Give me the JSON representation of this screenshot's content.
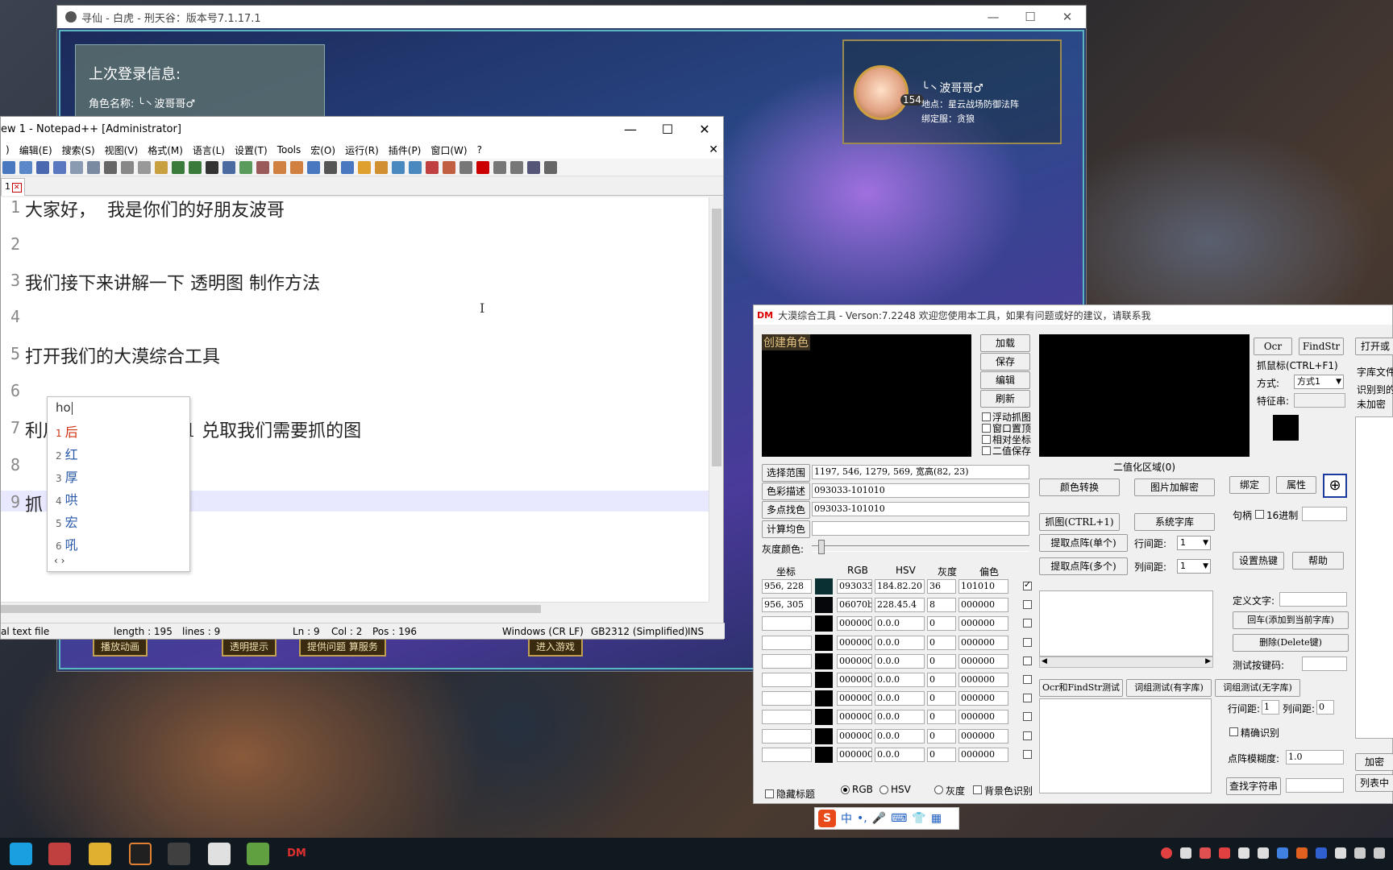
{
  "game": {
    "title": "寻仙 - 白虎 - 刑天谷：版本号7.1.17.1",
    "login_header": "上次登录信息:",
    "role_line": "角色名称: ╰丶波哥哥♂",
    "role_name": "╰丶波哥哥♂",
    "level": "154",
    "location": "地点：星云战场防御法阵",
    "server": "绑定服：贪狼",
    "btn_anim": "播放动画",
    "btn_tip": "透明提示",
    "btn_feedback": "提供问题 算服务",
    "btn_enter": "进入游戏"
  },
  "npp": {
    "title": "ew 1 - Notepad++ [Administrator]",
    "menu": [
      "编辑(E)",
      "搜索(S)",
      "视图(V)",
      "格式(M)",
      "语言(L)",
      "设置(T)",
      "Tools",
      "宏(O)",
      "运行(R)",
      "插件(P)",
      "窗口(W)",
      "?"
    ],
    "tab": "1",
    "lines": [
      {
        "n": "1",
        "t": "大家好，  我是你们的好朋友波哥"
      },
      {
        "n": "2",
        "t": ""
      },
      {
        "n": "3",
        "t": "我们接下来讲解一下 透明图 制作方法"
      },
      {
        "n": "4",
        "t": ""
      },
      {
        "n": "5",
        "t": "打开我们的大漠综合工具"
      },
      {
        "n": "6",
        "t": ""
      },
      {
        "n": "7",
        "t": "利用快捷键 CTRL+1 兑取我们需要抓的图"
      },
      {
        "n": "8",
        "t": ""
      },
      {
        "n": "9",
        "t": "抓"
      }
    ],
    "status": {
      "type": "al text file",
      "length": "length : 195",
      "lines": "lines : 9",
      "ln": "Ln : 9",
      "col": "Col : 2",
      "pos": "Pos : 196",
      "eol": "Windows (CR LF)",
      "enc": "GB2312 (Simplified)",
      "mode": "INS"
    }
  },
  "ime": {
    "input": "ho",
    "candidates": [
      {
        "n": "1",
        "c": "后"
      },
      {
        "n": "2",
        "c": "红"
      },
      {
        "n": "3",
        "c": "厚"
      },
      {
        "n": "4",
        "c": "哄"
      },
      {
        "n": "5",
        "c": "宏"
      },
      {
        "n": "6",
        "c": "吼"
      }
    ],
    "nav": "‹ ›"
  },
  "dm": {
    "logo": "DM",
    "title": "大漠综合工具 - Verson:7.2248  欢迎您使用本工具，如果有问题或好的建议，请联系我",
    "preview_label": "创建角色",
    "btn_load": "加载",
    "btn_save": "保存",
    "btn_edit": "编辑",
    "btn_refresh": "刷新",
    "chk_float": "浮动抓图",
    "chk_top": "窗口置顶",
    "chk_relative": "相对坐标",
    "chk_binary": "二值保存",
    "binary_area": "二值化区域(0)",
    "lbl_range": "选择范围",
    "val_range": "1197, 546, 1279, 569, 宽高(82, 23)",
    "lbl_color": "色彩描述",
    "val_color": "093033-101010",
    "lbl_multi": "多点找色",
    "val_multi": "093033-101010",
    "lbl_avg": "计算均色",
    "lbl_gray": "灰度颜色:",
    "col_coord": "坐标",
    "col_rgb": "RGB",
    "col_hsv": "HSV",
    "col_gray": "灰度",
    "col_offset": "偏色",
    "rows": [
      {
        "c": "956, 228",
        "rgb": "093033",
        "hsv": "184.82.20",
        "g": "36",
        "o": "101010",
        "on": true,
        "sw": "#0a3033"
      },
      {
        "c": "956, 305",
        "rgb": "06070b",
        "hsv": "228.45.4",
        "g": "8",
        "o": "000000",
        "on": false,
        "sw": "#06070b"
      },
      {
        "c": "",
        "rgb": "000000",
        "hsv": "0.0.0",
        "g": "0",
        "o": "000000",
        "on": false,
        "sw": "#000000"
      },
      {
        "c": "",
        "rgb": "000000",
        "hsv": "0.0.0",
        "g": "0",
        "o": "000000",
        "on": false,
        "sw": "#000000"
      },
      {
        "c": "",
        "rgb": "000000",
        "hsv": "0.0.0",
        "g": "0",
        "o": "000000",
        "on": false,
        "sw": "#000000"
      },
      {
        "c": "",
        "rgb": "000000",
        "hsv": "0.0.0",
        "g": "0",
        "o": "000000",
        "on": false,
        "sw": "#000000"
      },
      {
        "c": "",
        "rgb": "000000",
        "hsv": "0.0.0",
        "g": "0",
        "o": "000000",
        "on": false,
        "sw": "#000000"
      },
      {
        "c": "",
        "rgb": "000000",
        "hsv": "0.0.0",
        "g": "0",
        "o": "000000",
        "on": false,
        "sw": "#000000"
      },
      {
        "c": "",
        "rgb": "000000",
        "hsv": "0.0.0",
        "g": "0",
        "o": "000000",
        "on": false,
        "sw": "#000000"
      },
      {
        "c": "",
        "rgb": "000000",
        "hsv": "0.0.0",
        "g": "0",
        "o": "000000",
        "on": false,
        "sw": "#000000"
      }
    ],
    "chk_hide_title": "隐藏标题",
    "radio_rgb": "RGB",
    "radio_hsv": "HSV",
    "radio_gray": "灰度",
    "chk_bg": "背景色识别",
    "btn_colorconv": "颜色转换",
    "btn_imgdecrypt": "图片加解密",
    "btn_capture": "抓图(CTRL+1)",
    "btn_syslib": "系统字库",
    "btn_extract_single": "提取点阵(单个)",
    "btn_extract_multi": "提取点阵(多个)",
    "lbl_rowgap": "行间距:",
    "lbl_colgap": "列间距:",
    "val_rowgap": "1",
    "val_colgap": "1",
    "btn_ocr_test": "Ocr和FindStr测试",
    "btn_word_lib": "词组测试(有字库)",
    "btn_word_nolib": "词组测试(无字库)",
    "btn_ocr": "Ocr",
    "btn_findstr": "FindStr",
    "lbl_mouse": "抓鼠标(CTRL+F1)",
    "lbl_mode": "方式:",
    "val_mode": "方式1",
    "lbl_feature": "特征串:",
    "btn_bind": "绑定",
    "btn_prop": "属性",
    "lbl_handle": "句柄",
    "chk_hex": "16进制",
    "btn_hotkey": "设置热键",
    "btn_help": "帮助",
    "lbl_define": "定义文字:",
    "btn_enter_lib": "回车(添加到当前字库)",
    "btn_delete": "删除(Delete键)",
    "lbl_testkey": "测试按键码:",
    "lbl_rowgap2": "行间距:",
    "val_rowgap2": "1",
    "lbl_colgap2": "列间距:",
    "val_colgap2": "0",
    "chk_exact": "精确识别",
    "lbl_blur": "点阵模糊度:",
    "val_blur": "1.0",
    "btn_find": "查找字符串",
    "btn_open": "打开或",
    "lbl_libfile": "字库文件",
    "lbl_recog": "识别到的",
    "lbl_unenc": "未加密",
    "btn_addenc": "加密",
    "btn_listmid": "列表中"
  },
  "imebar": {
    "s": "S",
    "items": [
      "中",
      "•,",
      "🎤",
      "⌨",
      "👕",
      "▦"
    ]
  },
  "colors": {
    "accent": "#d00000",
    "ime_sel": "#d03010",
    "ime_cand": "#2a5aa8",
    "curline": "#e8e8ff"
  }
}
